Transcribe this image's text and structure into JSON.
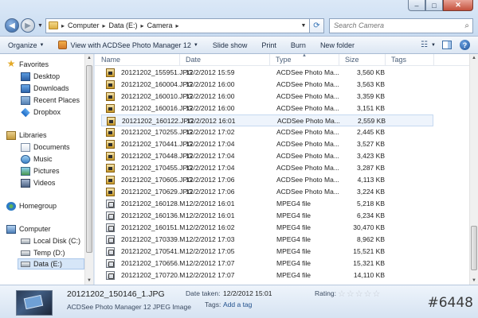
{
  "address": {
    "crumbs": [
      "Computer",
      "Data (E:)",
      "Camera"
    ]
  },
  "search": {
    "placeholder": "Search Camera"
  },
  "window_controls": {
    "minimize": "–",
    "maximize": "□",
    "close": "✕"
  },
  "toolbar": {
    "organize": "Organize",
    "view_with": "View with ACDSee Photo Manager 12",
    "slide_show": "Slide show",
    "print": "Print",
    "burn": "Burn",
    "new_folder": "New folder"
  },
  "nav": {
    "favorites": "Favorites",
    "desktop": "Desktop",
    "downloads": "Downloads",
    "recent_places": "Recent Places",
    "dropbox": "Dropbox",
    "libraries": "Libraries",
    "documents": "Documents",
    "music": "Music",
    "pictures": "Pictures",
    "videos": "Videos",
    "homegroup": "Homegroup",
    "computer": "Computer",
    "local_disk": "Local Disk (C:)",
    "temp": "Temp (D:)",
    "data": "Data (E:)"
  },
  "columns": {
    "name": "Name",
    "date": "Date",
    "type": "Type",
    "size": "Size",
    "tags": "Tags"
  },
  "files": [
    {
      "name": "20121202_155951.JPG",
      "date": "12/2/2012 15:59",
      "type": "ACDSee Photo Ma...",
      "size": "3,560 KB",
      "kind": "jpg"
    },
    {
      "name": "20121202_160004.JPG",
      "date": "12/2/2012 16:00",
      "type": "ACDSee Photo Ma...",
      "size": "3,563 KB",
      "kind": "jpg"
    },
    {
      "name": "20121202_160010.JPG",
      "date": "12/2/2012 16:00",
      "type": "ACDSee Photo Ma...",
      "size": "3,359 KB",
      "kind": "jpg"
    },
    {
      "name": "20121202_160016.JPG",
      "date": "12/2/2012 16:00",
      "type": "ACDSee Photo Ma...",
      "size": "3,151 KB",
      "kind": "jpg"
    },
    {
      "name": "20121202_160122.JPG",
      "date": "12/2/2012 16:01",
      "type": "ACDSee Photo Ma...",
      "size": "2,559 KB",
      "kind": "jpg"
    },
    {
      "name": "20121202_170255.JPG",
      "date": "12/2/2012 17:02",
      "type": "ACDSee Photo Ma...",
      "size": "2,445 KB",
      "kind": "jpg"
    },
    {
      "name": "20121202_170441.JPG",
      "date": "12/2/2012 17:04",
      "type": "ACDSee Photo Ma...",
      "size": "3,527 KB",
      "kind": "jpg"
    },
    {
      "name": "20121202_170448.JPG",
      "date": "12/2/2012 17:04",
      "type": "ACDSee Photo Ma...",
      "size": "3,423 KB",
      "kind": "jpg"
    },
    {
      "name": "20121202_170455.JPG",
      "date": "12/2/2012 17:04",
      "type": "ACDSee Photo Ma...",
      "size": "3,287 KB",
      "kind": "jpg"
    },
    {
      "name": "20121202_170605.JPG",
      "date": "12/2/2012 17:06",
      "type": "ACDSee Photo Ma...",
      "size": "4,113 KB",
      "kind": "jpg"
    },
    {
      "name": "20121202_170629.JPG",
      "date": "12/2/2012 17:06",
      "type": "ACDSee Photo Ma...",
      "size": "3,224 KB",
      "kind": "jpg"
    },
    {
      "name": "20121202_160128.M...",
      "date": "12/2/2012 16:01",
      "type": "MPEG4 file",
      "size": "5,218 KB",
      "kind": "mp4"
    },
    {
      "name": "20121202_160136.M...",
      "date": "12/2/2012 16:01",
      "type": "MPEG4 file",
      "size": "6,234 KB",
      "kind": "mp4"
    },
    {
      "name": "20121202_160151.M...",
      "date": "12/2/2012 16:02",
      "type": "MPEG4 file",
      "size": "30,470 KB",
      "kind": "mp4"
    },
    {
      "name": "20121202_170339.M...",
      "date": "12/2/2012 17:03",
      "type": "MPEG4 file",
      "size": "8,962 KB",
      "kind": "mp4"
    },
    {
      "name": "20121202_170541.M...",
      "date": "12/2/2012 17:05",
      "type": "MPEG4 file",
      "size": "15,521 KB",
      "kind": "mp4"
    },
    {
      "name": "20121202_170656.M...",
      "date": "12/2/2012 17:07",
      "type": "MPEG4 file",
      "size": "15,321 KB",
      "kind": "mp4"
    },
    {
      "name": "20121202_170720.M...",
      "date": "12/2/2012 17:07",
      "type": "MPEG4 file",
      "size": "14,110 KB",
      "kind": "mp4"
    }
  ],
  "selected_row_index": 4,
  "details": {
    "file_name": "20121202_150146_1.JPG",
    "file_type": "ACDSee Photo Manager 12 JPEG Image",
    "date_taken_label": "Date taken:",
    "date_taken_value": "12/2/2012 15:01",
    "tags_label": "Tags:",
    "tags_value": "Add a tag",
    "rating_label": "Rating:",
    "rating_stars": 0,
    "rating_max": 5
  },
  "watermark": "#6448"
}
